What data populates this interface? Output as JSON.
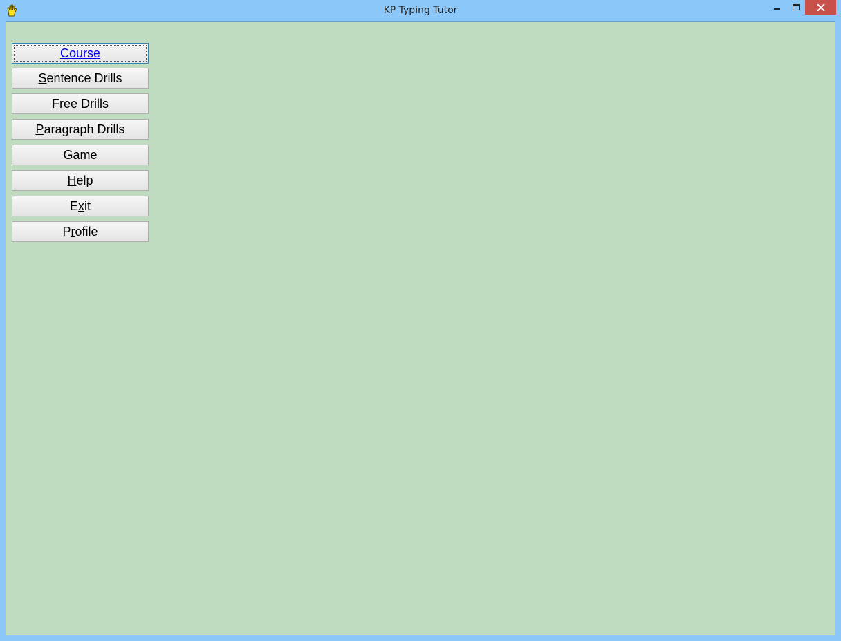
{
  "window": {
    "title": "KP Typing Tutor",
    "icon": "hand-icon",
    "controls": [
      "minimize-icon",
      "maximize-icon",
      "close-icon"
    ]
  },
  "colors": {
    "frame": "#8cc7fa",
    "client_background": "#c0dcc0",
    "close_button": "#c7504a",
    "active_text": "#0000ee"
  },
  "menu": {
    "items": [
      {
        "pre": "",
        "key": "C",
        "post": "ourse",
        "active": true
      },
      {
        "pre": "",
        "key": "S",
        "post": "entence Drills",
        "active": false
      },
      {
        "pre": "",
        "key": "F",
        "post": "ree Drills",
        "active": false
      },
      {
        "pre": "",
        "key": "P",
        "post": "aragraph Drills",
        "active": false
      },
      {
        "pre": "",
        "key": "G",
        "post": "ame",
        "active": false
      },
      {
        "pre": "",
        "key": "H",
        "post": "elp",
        "active": false
      },
      {
        "pre": "E",
        "key": "x",
        "post": "it",
        "active": false
      },
      {
        "pre": "P",
        "key": "r",
        "post": "ofile",
        "active": false
      }
    ]
  }
}
